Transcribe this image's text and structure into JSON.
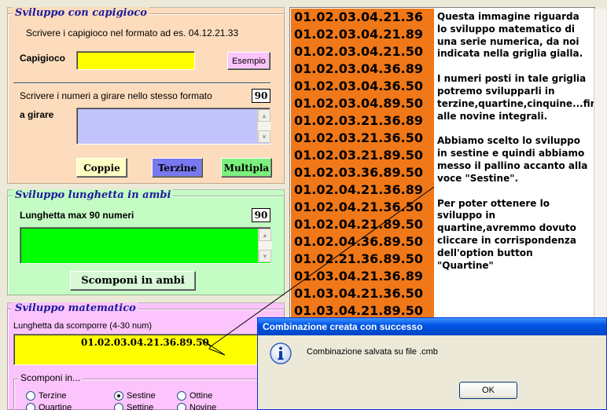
{
  "capigioco_section": {
    "title": "Sviluppo con capigioco",
    "instruction": "Scrivere i capigioco nel formato ad es. 04.12.21.33",
    "field_label": "Capigioco",
    "example_button": "Esempio",
    "numbers_instruction": "Scrivere i numeri a girare nello stesso formato",
    "numbers_counter": "90",
    "numbers_label": "a girare",
    "buttons": {
      "coppie": "Coppie",
      "terzine": "Terzine",
      "multipla": "Multipla"
    }
  },
  "lunghetta_section": {
    "title": "Sviluppo lunghetta in ambi",
    "label": "Lunghetta max 90 numeri",
    "counter": "90",
    "button": "Scomponi in ambi"
  },
  "matematico_section": {
    "title": "Sviluppo matematico",
    "label": "Lunghetta da scomporre (4-30 num)",
    "value": "01.02.03.04.21.36.89.50",
    "scomponi_label": "Scomponi in...",
    "options": [
      {
        "label": "Terzine",
        "selected": false
      },
      {
        "label": "Sestine",
        "selected": true
      },
      {
        "label": "Ottine",
        "selected": false
      },
      {
        "label": "Quartine",
        "selected": false
      },
      {
        "label": "Settine",
        "selected": false
      },
      {
        "label": "Novine",
        "selected": false
      }
    ]
  },
  "results": [
    "01.02.03.04.21.36",
    "01.02.03.04.21.89",
    "01.02.03.04.21.50",
    "01.02.03.04.36.89",
    "01.02.03.04.36.50",
    "01.02.03.04.89.50",
    "01.02.03.21.36.89",
    "01.02.03.21.36.50",
    "01.02.03.21.89.50",
    "01.02.03.36.89.50",
    "01.02.04.21.36.89",
    "01.02.04.21.36.50",
    "01.02.04.21.89.50",
    "01.02.04.36.89.50",
    "01.02.21.36.89.50",
    "01.03.04.21.36.89",
    "01.03.04.21.36.50",
    "01.03.04.21.89.50"
  ],
  "notes": [
    "Questa immagine riguarda lo sviluppo matematico di una serie numerica, da noi indicata nella griglia gialla.",
    "I numeri posti in tale griglia potremo svilupparli in terzine,quartine,cinquine...fino alle novine integrali.",
    "Abbiamo scelto lo sviluppo in sestine e quindi abbiamo messo il pallino accanto alla voce \"Sestine\".",
    "Per poter ottenere lo sviluppo in quartine,avremmo dovuto cliccare in corrispondenza dell'option button \"Quartine\""
  ],
  "dialog": {
    "title": "Combinazione creata con successo",
    "message": "Combinazione salvata su file .cmb",
    "ok": "OK"
  },
  "colors": {
    "capigioco_bg": "#fcdcbc",
    "lunghetta_bg": "#c4fcc4",
    "matematico_bg": "#fcc4fc",
    "yellow_field": "#ffff00",
    "lavender_field": "#c4c4fc",
    "green_field": "#00ff00",
    "orange_list": "#f07818"
  }
}
